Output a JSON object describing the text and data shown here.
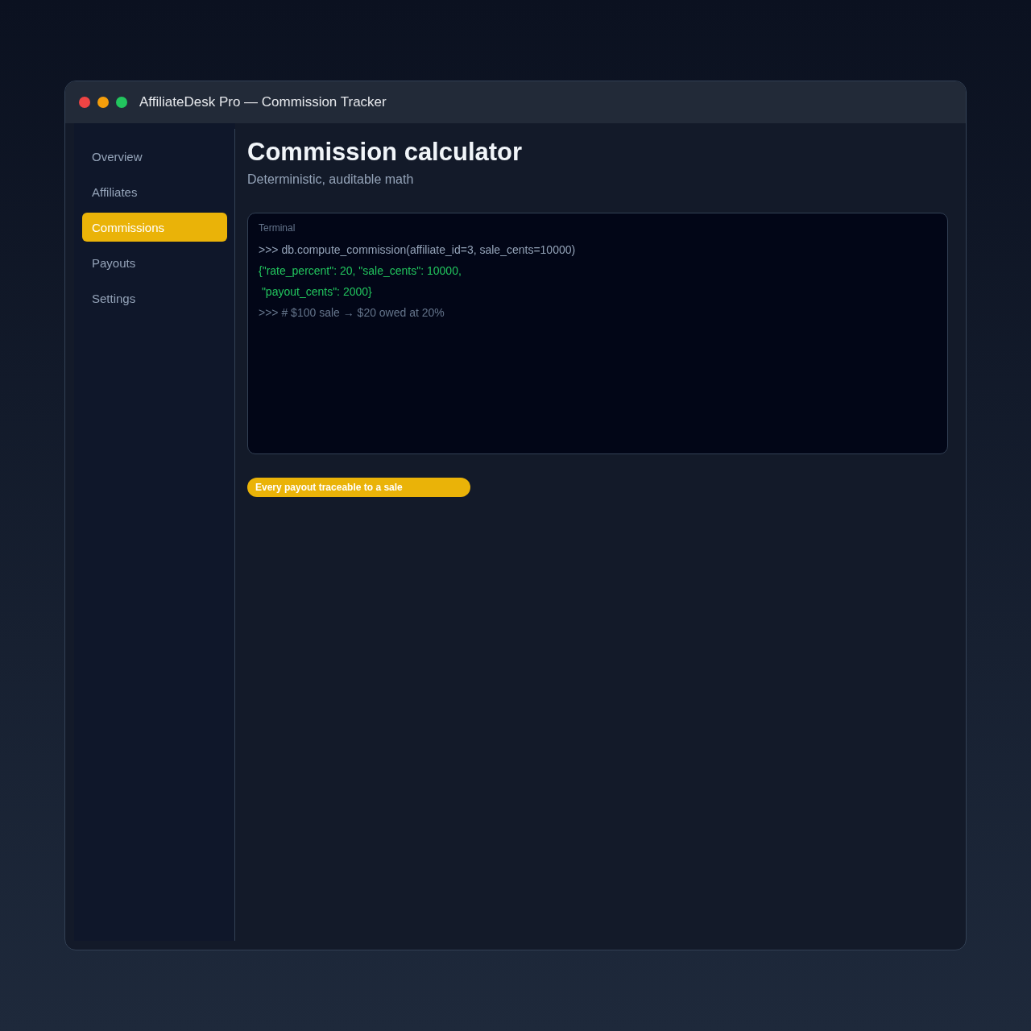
{
  "window": {
    "title": "AffiliateDesk Pro — Commission Tracker"
  },
  "sidebar": {
    "items": [
      {
        "label": "Overview",
        "selected": false
      },
      {
        "label": "Affiliates",
        "selected": false
      },
      {
        "label": "Commissions",
        "selected": true
      },
      {
        "label": "Payouts",
        "selected": false
      },
      {
        "label": "Settings",
        "selected": false
      }
    ]
  },
  "header": {
    "title": "Commission calculator",
    "subtitle": "Deterministic, auditable math"
  },
  "terminal": {
    "label": "Terminal",
    "lines": [
      {
        "kind": "command",
        "text": ">>> db.compute_commission(affiliate_id=3, sale_cents=10000)"
      },
      {
        "kind": "output",
        "text": "{\"rate_percent\": 20, \"sale_cents\": 10000,"
      },
      {
        "kind": "output",
        "text": " \"payout_cents\": 2000}"
      },
      {
        "kind": "comment",
        "text": ">>> # $100 sale → $20 owed at 20%"
      }
    ]
  },
  "badge": {
    "text": "Every payout traceable to a sale"
  }
}
